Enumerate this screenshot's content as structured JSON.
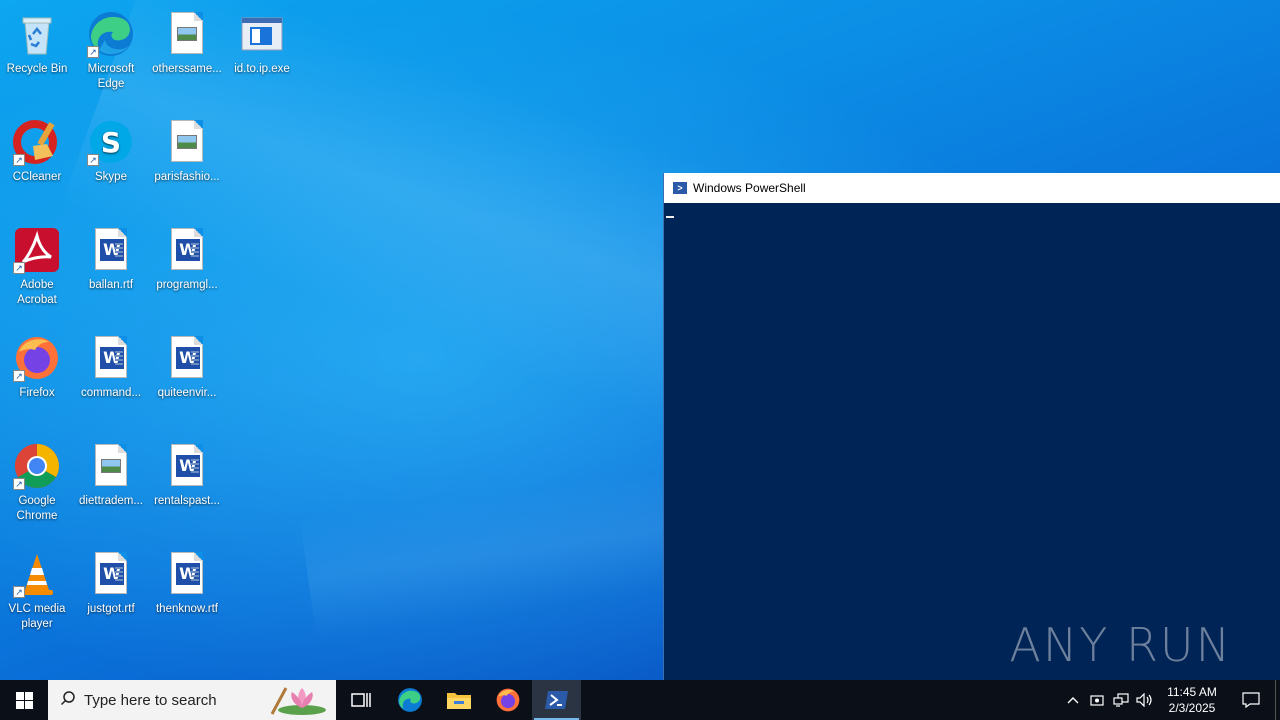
{
  "desktop": {
    "icons": [
      {
        "label": "Recycle Bin"
      },
      {
        "label": "Microsoft Edge"
      },
      {
        "label": "otherssame..."
      },
      {
        "label": "id.to.ip.exe"
      },
      {
        "label": "CCleaner"
      },
      {
        "label": "Skype"
      },
      {
        "label": "parisfashio..."
      },
      {
        "label": "Adobe Acrobat"
      },
      {
        "label": "ballan.rtf"
      },
      {
        "label": "programgl..."
      },
      {
        "label": "Firefox"
      },
      {
        "label": "command..."
      },
      {
        "label": "quiteenvir..."
      },
      {
        "label": "Google Chrome"
      },
      {
        "label": "diettradem..."
      },
      {
        "label": "rentalspast..."
      },
      {
        "label": "VLC media player"
      },
      {
        "label": "justgot.rtf"
      },
      {
        "label": "thenknow.rtf"
      }
    ]
  },
  "powershell": {
    "title": "Windows PowerShell"
  },
  "watermark": "ANY RUN",
  "taskbar": {
    "search_placeholder": "Type here to search",
    "apps": [
      "task-view",
      "edge",
      "file-explorer",
      "firefox",
      "powershell"
    ],
    "active_app": "powershell",
    "clock_time": "11:45 AM",
    "clock_date": "2/3/2025"
  },
  "colors": {
    "powershell_bg": "#012456",
    "taskbar_bg": "#0b0f18",
    "accent": "#76b9ed"
  }
}
